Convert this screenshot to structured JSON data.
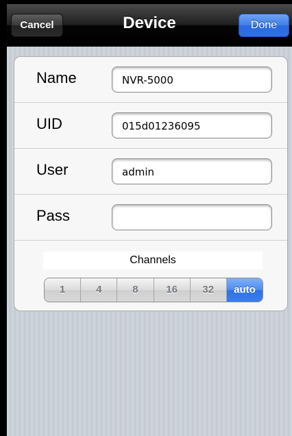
{
  "navbar": {
    "title": "Device",
    "cancel_label": "Cancel",
    "done_label": "Done"
  },
  "form": {
    "rows": [
      {
        "label": "Name",
        "value": "NVR-5000"
      },
      {
        "label": "UID",
        "value": "015d01236095"
      },
      {
        "label": "User",
        "value": "admin"
      },
      {
        "label": "Pass",
        "value": ""
      }
    ],
    "channels_title": "Channels",
    "channel_options": [
      "1",
      "4",
      "8",
      "16",
      "32",
      "auto"
    ],
    "channel_selected": "auto"
  },
  "colors": {
    "accent": "#3a7dec",
    "navbar": "#1f1f1f",
    "background": "#c5ccd4"
  }
}
